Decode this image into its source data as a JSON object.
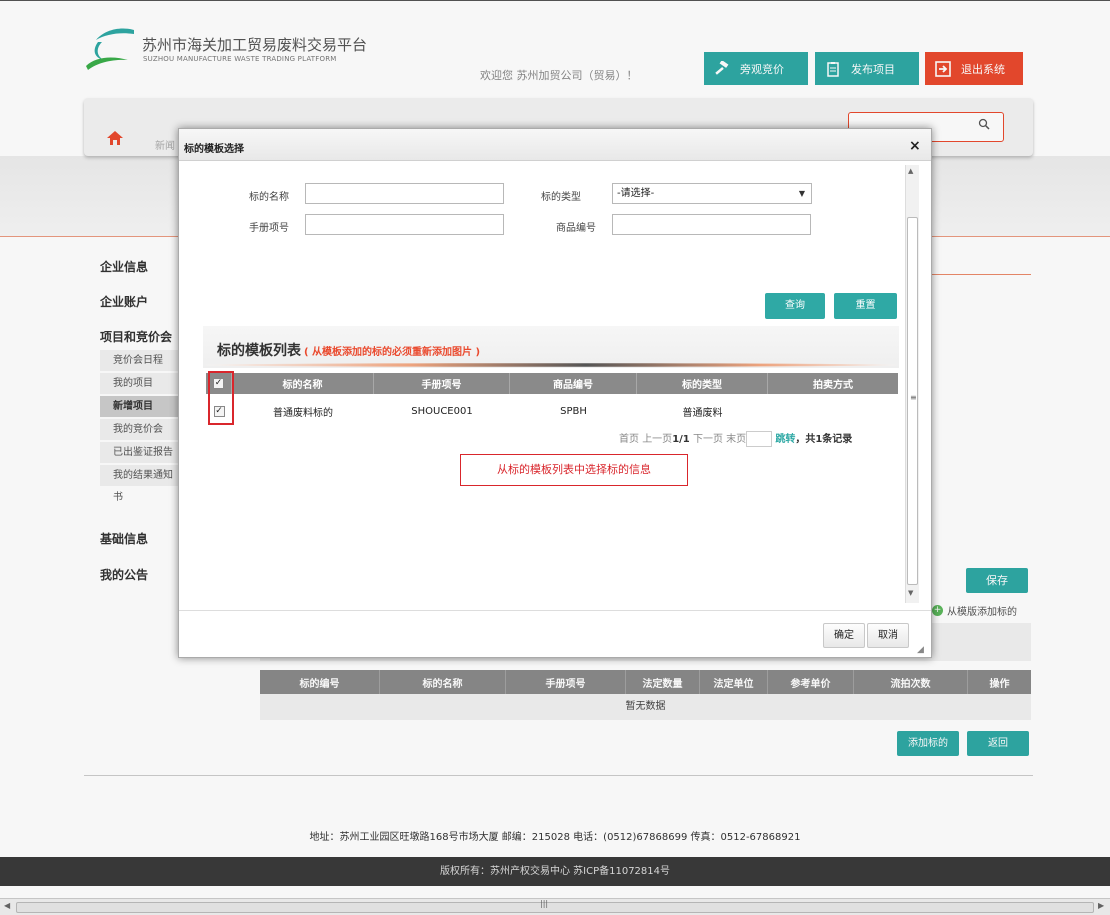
{
  "site": {
    "title": "苏州市海关加工贸易废料交易平台",
    "subtitle": "SUZHOU MANUFACTURE WASTE TRADING PLATFORM",
    "welcome": "欢迎您 苏州加贸公司（贸易）！"
  },
  "header_buttons": {
    "watch": "旁观竞价",
    "publish": "发布项目",
    "logout": "退出系统"
  },
  "nav": {
    "news": "新闻"
  },
  "sidebar": {
    "company_info": "企业信息",
    "company_account": "企业账户",
    "projects": "项目和竞价会",
    "items": [
      "竞价会日程",
      "我的项目",
      "新增项目",
      "我的竞价会",
      "已出鉴证报告的",
      "我的结果通知书"
    ],
    "basic_info": "基础信息",
    "my_notice": "我的公告"
  },
  "page": {
    "save": "保存",
    "add_from_template": "从模版添加标的",
    "table_headers": [
      "标的编号",
      "标的名称",
      "手册项号",
      "法定数量",
      "法定单位",
      "参考单价",
      "流拍次数",
      "操作"
    ],
    "empty": "暂无数据",
    "add_button": "添加标的",
    "back_button": "返回"
  },
  "footer": {
    "address": "地址：苏州工业园区旺墩路168号市场大厦 邮编：215028 电话：(0512)67868699 传真：0512-67868921",
    "copyright": "版权所有：苏州产权交易中心 苏ICP备11072814号"
  },
  "modal": {
    "title": "标的模板选择",
    "close": "×",
    "form": {
      "name_label": "标的名称",
      "name_value": "",
      "type_label": "标的类型",
      "type_selected": "-请选择-",
      "manual_label": "手册项号",
      "manual_value": "",
      "goods_label": "商品编号",
      "goods_value": ""
    },
    "query": "查询",
    "reset": "重置",
    "list_title": "标的模板列表",
    "list_note": "( 从模板添加的标的必须重新添加图片 )",
    "columns": [
      "标的名称",
      "手册项号",
      "商品编号",
      "标的类型",
      "拍卖方式"
    ],
    "rows": [
      {
        "checked": true,
        "name": "普通废料标的",
        "manual": "SHOUCE001",
        "goods": "SPBH",
        "type": "普通废料",
        "auction": ""
      }
    ],
    "pager": {
      "first": "首页",
      "prev": "上一页",
      "page": "1/1",
      "next": "下一页",
      "last": "末页",
      "jump": "跳转",
      "total": "，共1条记录"
    },
    "hint": "从标的模板列表中选择标的信息",
    "ok": "确定",
    "cancel": "取消"
  },
  "colors": {
    "accent": "#2fa9a5",
    "danger": "#ea4a2e",
    "highlight": "#d9262c"
  }
}
